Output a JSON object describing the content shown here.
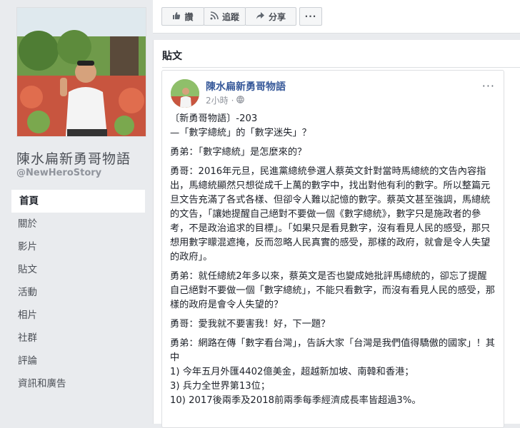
{
  "page": {
    "name": "陳水扁新勇哥物語",
    "handle": "@NewHeroStory"
  },
  "nav": [
    "首頁",
    "關於",
    "影片",
    "貼文",
    "活動",
    "相片",
    "社群",
    "評論",
    "資訊和廣告"
  ],
  "actions": {
    "like": "讚",
    "follow": "追蹤",
    "share": "分享",
    "more": "···"
  },
  "posts_section": {
    "title": "貼文"
  },
  "post": {
    "author": "陳水扁新勇哥物語",
    "time": "2小時",
    "menu": "···",
    "lines": [
      "〔新勇哥物語〕-203\n—「數字總統」的「數字迷失」？",
      "勇弟：「數字總統」是怎麼來的？",
      "勇哥：2016年元旦，民進黨總統參選人蔡英文針對當時馬總統的文告內容指出，馬總統顯然只想從成千上萬的數字中，找出對他有利的數字。所以整篇元旦文告充滿了各式各樣、但卻令人難以記憶的數字。蔡英文甚至強調，馬總統的文告，「讓她提醒自己絕對不要做一個《數字總統》，數字只是施政者的參考，不是政治追求的目標」。「如果只是看見數字，沒有看見人民的感受，那只想用數字矇混遮掩，反而忽略人民真實的感受，那樣的政府，就會是令人失望的政府」。",
      "勇弟：就任總統2年多以來，蔡英文是否也變成她批評馬總統的，卻忘了提醒自己絕對不要做一個「數字總統」，不能只看數字，而沒有看見人民的感受，那樣的政府是會令人失望的？",
      "勇哥：愛我就不要害我！好，下一題？",
      "勇弟：網路在傳「數字看台灣」，告訴大家「台灣是我們值得驕傲的國家」！其中\n1) 今年五月外匯4402億美金，超越新加坡、南韓和香港；\n3) 兵力全世界第13位；\n10) 2017後兩季及2018前兩季每季經濟成長率皆超過3%。"
    ]
  }
}
